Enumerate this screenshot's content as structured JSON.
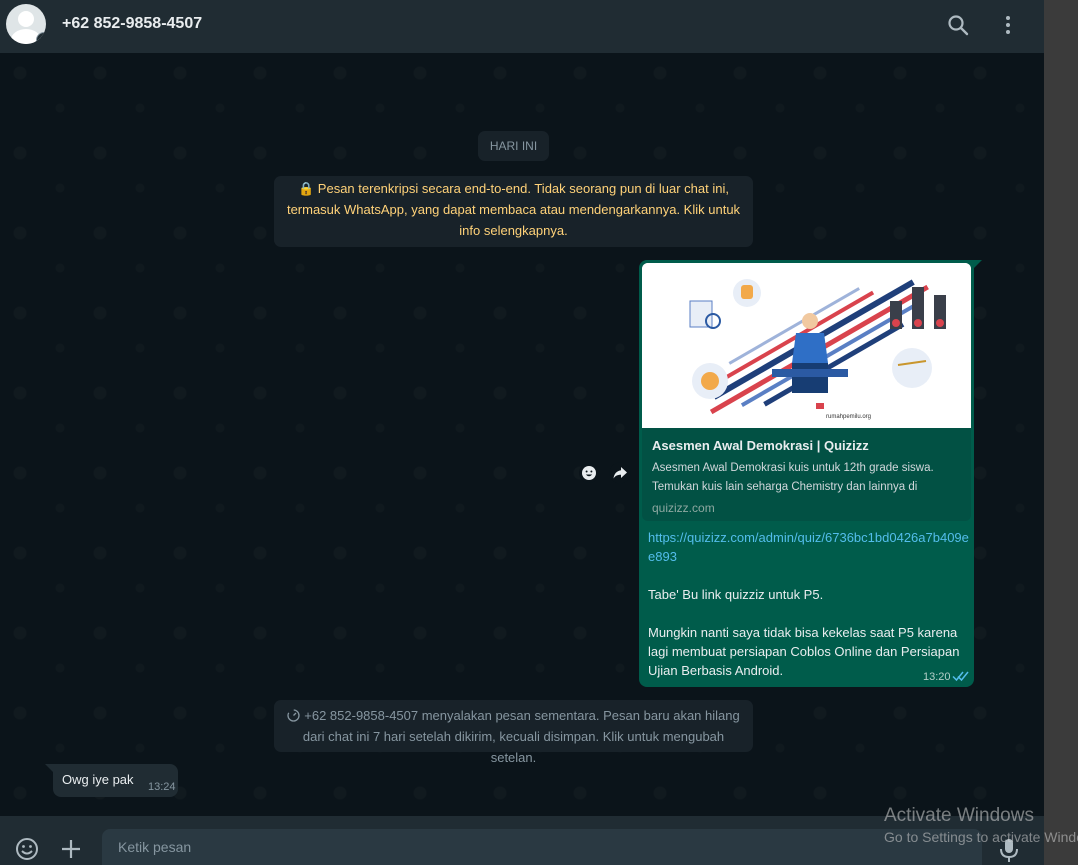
{
  "header": {
    "contact_name": "+62 852-9858-4507",
    "icons": [
      "default-avatar-icon",
      "search-icon",
      "menu-icon"
    ]
  },
  "chat": {
    "day_label": "HARI INI",
    "encryption_notice": "🔒 Pesan terenkripsi secara end-to-end. Tidak seorang pun di luar chat ini, termasuk WhatsApp, yang dapat membaca atau mendengarkannya. Klik untuk info selengkapnya.",
    "outgoing": {
      "preview_title": "Asesmen Awal Demokrasi | Quizizz",
      "preview_description": "Asesmen Awal Demokrasi kuis untuk 12th grade siswa. Temukan kuis lain seharga Chemistry dan lainnya di",
      "preview_domain": "quizizz.com",
      "link": "https://quizizz.com/admin/quiz/6736bc1bd0426a7b409ee893",
      "text": "Tabe' Bu link quizziz untuk  P5.\n\nMungkin nanti saya tidak bisa kekelas saat P5 karena lagi membuat persiapan Coblos Online dan Persiapan Ujian Berbasis Android.",
      "time": "13:20",
      "status": "read"
    },
    "disappearing_notice": "+62 852-9858-4507 menyalakan pesan sementara. Pesan baru akan hilang dari chat ini 7 hari setelah dikirim, kecuali disimpan. Klik untuk mengubah setelan.",
    "incoming": {
      "text": "Owg iye pak",
      "time": "13:24"
    }
  },
  "footer": {
    "placeholder": "Ketik pesan"
  },
  "watermark": {
    "title": "Activate Windows",
    "subtitle": "Go to Settings to activate Windows."
  },
  "colors": {
    "header_bg": "#202c33",
    "chat_bg": "#0b141a",
    "outgoing_bubble": "#005c4b",
    "link": "#53bdeb",
    "encryption_text": "#ffd279"
  }
}
